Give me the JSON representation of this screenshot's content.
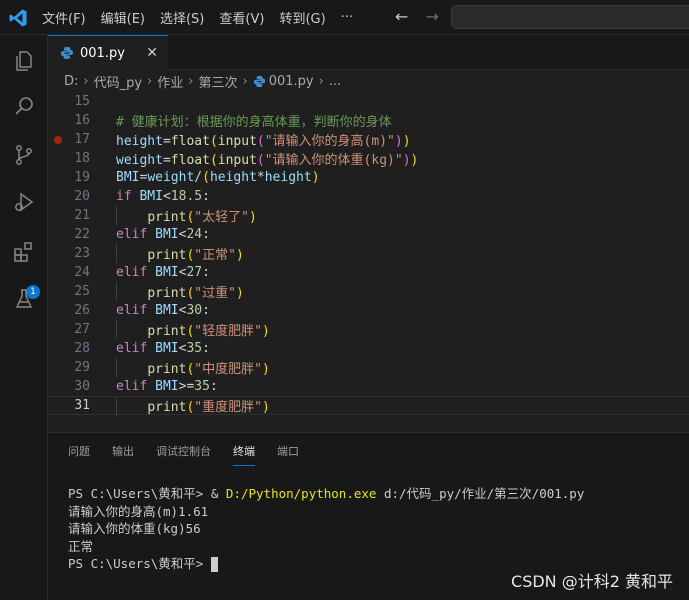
{
  "menu": {
    "items": [
      "文件(F)",
      "编辑(E)",
      "选择(S)",
      "查看(V)",
      "转到(G)",
      "···"
    ]
  },
  "navigation": {
    "back": "←",
    "forward": "→"
  },
  "tab": {
    "name": "001.py",
    "close": "✕"
  },
  "breadcrumb": {
    "parts": [
      "D:",
      "代码_py",
      "作业",
      "第三次",
      "001.py",
      "..."
    ]
  },
  "activity": {
    "extensions_badge": "1"
  },
  "editor": {
    "line_numbers": [
      "15",
      "16",
      "17",
      "18",
      "19",
      "20",
      "21",
      "22",
      "23",
      "24",
      "25",
      "26",
      "27",
      "28",
      "29",
      "30",
      "31"
    ],
    "current_line": "31",
    "breakpoint_line": "17",
    "lines": [
      "",
      "# 健康计划：根据你的身高体重，判断你的身体",
      "height=float(input(\"请输入你的身高(m)\"))",
      "weight=float(input(\"请输入你的体重(kg)\"))",
      "BMI=weight/(height*height)",
      "if BMI<18.5:",
      "    print(\"太轻了\")",
      "elif BMI<24:",
      "    print(\"正常\")",
      "elif BMI<27:",
      "    print(\"过重\")",
      "elif BMI<30:",
      "    print(\"轻度肥胖\")",
      "elif BMI<35:",
      "    print(\"中度肥胖\")",
      "elif BMI>=35:",
      "    print(\"重度肥胖\")"
    ]
  },
  "panel": {
    "tabs": [
      "问题",
      "输出",
      "调试控制台",
      "终端",
      "端口"
    ],
    "active_tab": "终端",
    "terminal": {
      "prompt1": "PS C:\\Users\\黄和平> & ",
      "exe": "D:/Python/python.exe",
      "arg": " d:/代码_py/作业/第三次/001.py",
      "out1": "请输入你的身高(m)1.61",
      "out2": "请输入你的体重(kg)56",
      "out3": "正常",
      "prompt2": "PS C:\\Users\\黄和平> "
    }
  },
  "watermark": "CSDN @计科2 黄和平",
  "colors": {
    "accent": "#0078d4",
    "breakpoint": "#a1260d"
  }
}
